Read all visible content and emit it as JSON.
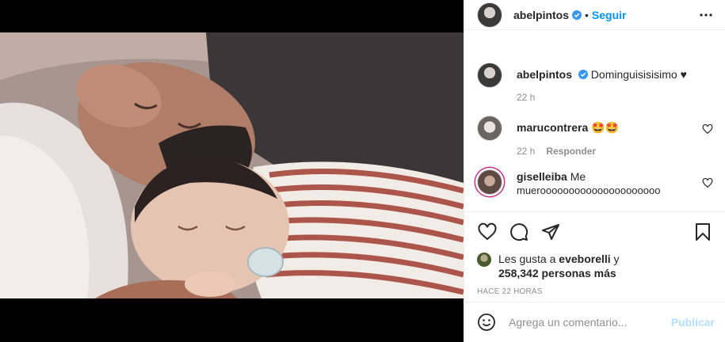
{
  "post": {
    "author": "abelpintos",
    "follow_label": "Seguir",
    "separator": "•",
    "caption": {
      "author": "abelpintos",
      "text": "Dominguisisisimo ♥",
      "time": "22 h"
    },
    "comments": [
      {
        "author": "marucontrera",
        "text": "🤩🤩",
        "time": "22 h",
        "reply_label": "Responder"
      },
      {
        "author": "giselleiba",
        "text": "Me",
        "text2": "muerooooooooooooooooooooo"
      }
    ],
    "likes": {
      "prefix": "Les gusta a",
      "user": "eveborelli",
      "and": "y",
      "count": "258,342 personas más"
    },
    "timestamp": "Hace 22 horas"
  },
  "add_comment": {
    "placeholder": "Agrega un comentario...",
    "publish_label": "Publicar"
  },
  "colors": {
    "link": "#0095f6",
    "publish_disabled": "#b2dffc",
    "muted": "#8e8e8e",
    "verified": "#3897f0"
  },
  "icons": {
    "verified": "verified-badge-icon",
    "more": "more-options-icon",
    "like": "heart-icon",
    "comment": "comment-bubble-icon",
    "share": "paper-plane-icon",
    "save": "bookmark-icon",
    "emoji": "emoji-smiley-icon"
  }
}
